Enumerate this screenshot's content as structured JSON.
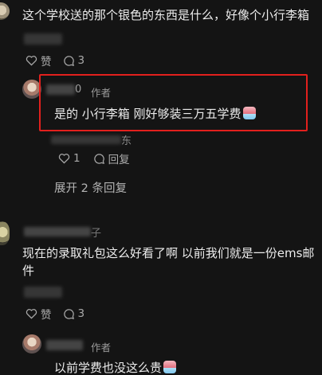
{
  "comments": [
    {
      "text": "这个学校送的那个银色的东西是什么，好像个小行李箱",
      "likes_label": "赞",
      "reply_count": "3"
    },
    {
      "author_tag": "作者",
      "author_tail": "0",
      "text": "是的 小行李箱 刚好够装三万五学费",
      "sub_tail": "东",
      "likes": "1",
      "reply_label": "回复"
    },
    {
      "expand_label": "展开 2 条回复"
    },
    {
      "author_tail": "子",
      "text": "现在的录取礼包这么好看了啊 以前我们就是一份ems邮件",
      "likes_label": "赞",
      "reply_count": "3"
    },
    {
      "author_tag": "作者",
      "text": "以前学费也没这么贵"
    }
  ],
  "colors": {
    "background": "#141414",
    "highlight": "#e2201d"
  }
}
